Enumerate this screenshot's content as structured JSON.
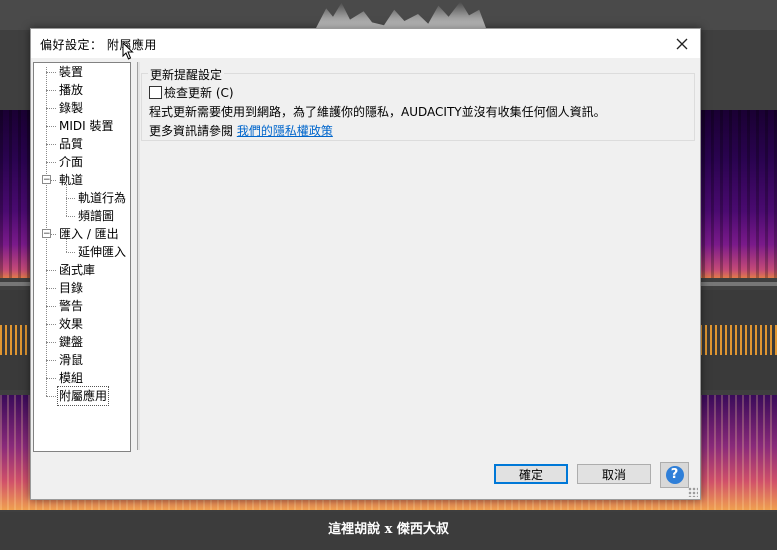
{
  "dialog": {
    "title": "偏好設定： 附屬應用",
    "close_icon": "close-icon"
  },
  "tree": {
    "items": [
      {
        "label": "裝置",
        "level": 0
      },
      {
        "label": "播放",
        "level": 0
      },
      {
        "label": "錄製",
        "level": 0
      },
      {
        "label": "MIDI 裝置",
        "level": 0
      },
      {
        "label": "品質",
        "level": 0
      },
      {
        "label": "介面",
        "level": 0
      },
      {
        "label": "軌道",
        "level": 0,
        "expanded": true
      },
      {
        "label": "軌道行為",
        "level": 1
      },
      {
        "label": "頻譜圖",
        "level": 1
      },
      {
        "label": "匯入 / 匯出",
        "level": 0,
        "expanded": true
      },
      {
        "label": "延伸匯入",
        "level": 1
      },
      {
        "label": "函式庫",
        "level": 0
      },
      {
        "label": "目錄",
        "level": 0
      },
      {
        "label": "警告",
        "level": 0
      },
      {
        "label": "效果",
        "level": 0
      },
      {
        "label": "鍵盤",
        "level": 0
      },
      {
        "label": "滑鼠",
        "level": 0
      },
      {
        "label": "模組",
        "level": 0
      },
      {
        "label": "附屬應用",
        "level": 0,
        "selected": true
      }
    ]
  },
  "update_settings": {
    "group_title": "更新提醒設定",
    "checkbox_label": "檢查更新 (C)",
    "checkbox_checked": false,
    "privacy_text": "程式更新需要使用到網路，為了維護你的隱私，AUDACITY並沒有收集任何個人資訊。",
    "more_info_prefix": "更多資訊請參閱 ",
    "privacy_link": "我們的隱私權政策"
  },
  "buttons": {
    "ok": "確定",
    "cancel": "取消",
    "help": "?"
  },
  "background": {
    "caption": "這裡胡說 x 傑西大叔"
  },
  "colors": {
    "accent": "#0078d7",
    "link": "#0066cc",
    "waveform": "#f2a030"
  }
}
